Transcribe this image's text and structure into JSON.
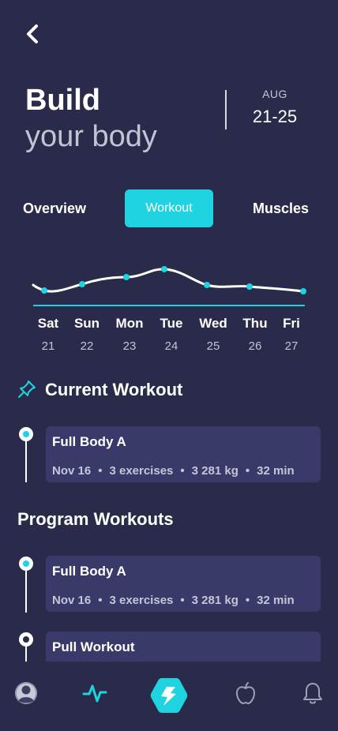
{
  "header": {
    "title_main": "Build",
    "title_sub": "your body",
    "date_month": "AUG",
    "date_range": "21-25"
  },
  "tabs": [
    {
      "label": "Overview",
      "active": false
    },
    {
      "label": "Workout",
      "active": true
    },
    {
      "label": "Muscles",
      "active": false
    }
  ],
  "week": {
    "days": [
      {
        "name": "Sat",
        "num": "21"
      },
      {
        "name": "Sun",
        "num": "22"
      },
      {
        "name": "Mon",
        "num": "23"
      },
      {
        "name": "Tue",
        "num": "24"
      },
      {
        "name": "Wed",
        "num": "25"
      },
      {
        "name": "Thu",
        "num": "26"
      },
      {
        "name": "Fri",
        "num": "27"
      }
    ]
  },
  "current_workout": {
    "section_title": "Current Workout",
    "card": {
      "title": "Full Body A",
      "date": "Nov 16",
      "exercises": "3 exercises",
      "weight": "3 281 kg",
      "duration": "32 min"
    }
  },
  "program_workouts": {
    "section_title": "Program Workouts",
    "cards": [
      {
        "title": "Full Body A",
        "date": "Nov 16",
        "exercises": "3 exercises",
        "weight": "3 281 kg",
        "duration": "32 min"
      },
      {
        "title": "Pull Workout"
      }
    ]
  },
  "bottom_nav": {
    "items": [
      "profile-icon",
      "activity-icon",
      "lightning-icon",
      "apple-icon",
      "bell-icon"
    ]
  },
  "colors": {
    "background": "#2a2b4a",
    "accent": "#1fd3e1",
    "card": "#3a3a6a"
  }
}
